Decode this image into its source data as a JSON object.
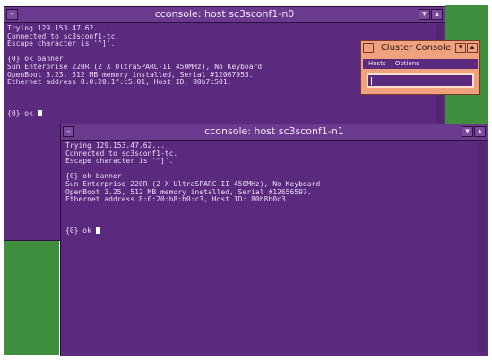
{
  "window_back": {
    "title": "cconsole: host sc3sconf1-n0",
    "lines": [
      "Trying 129.153.47.62...",
      "Connected to sc3sconf1-tc.",
      "Escape character is '^]'.",
      "",
      "{0} ok banner",
      "Sun Enterprise 220R (2 X UltraSPARC-II 450MHz), No Keyboard",
      "OpenBoot 3.23, 512 MB memory installed, Serial #12067953.",
      "Ethernet address 8:0:20:1f:c5:01, Host ID: 80b7c501.",
      "",
      "",
      "",
      "{0} ok "
    ]
  },
  "window_front": {
    "title": "cconsole: host sc3sconf1-n1",
    "lines": [
      "Trying 129.153.47.62...",
      "Connected to sc3sconf1-tc.",
      "Escape character is '^]'.",
      "",
      "{0} ok banner",
      "Sun Enterprise 220R (2 X UltraSPARC-II 450MHz), No Keyboard",
      "OpenBoot 3.25, 512 MB memory installed, Serial #12656597.",
      "Ethernet address 8:0:20:b8:b0:c3, Host ID: 80b8b0c3.",
      "",
      "",
      "",
      "{0} ok "
    ]
  },
  "cluster_console": {
    "title": "Cluster Console",
    "menu": [
      "Hosts",
      "Options"
    ],
    "input_value": ""
  }
}
